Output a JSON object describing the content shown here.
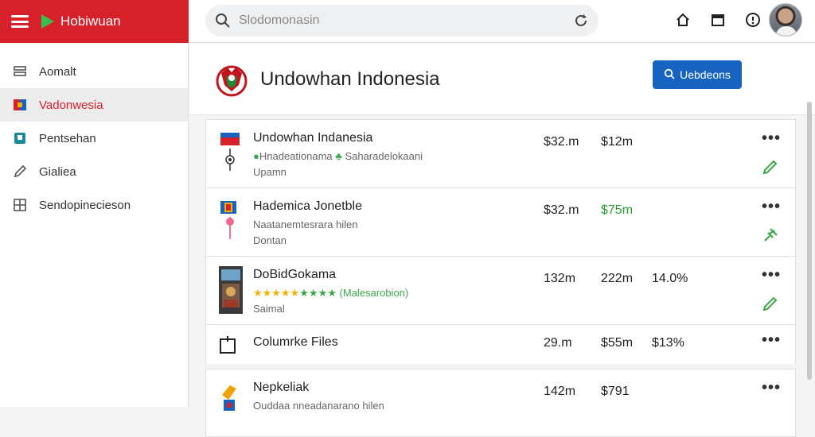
{
  "app": {
    "name": "Hobiwuan",
    "accent": "#d6202a"
  },
  "search": {
    "placeholder": "Slodomonasin"
  },
  "topbar": {
    "icons": [
      "home-icon",
      "calendar-icon",
      "info-icon",
      "avatar"
    ]
  },
  "sidebar": {
    "items": [
      {
        "label": "Aomalt",
        "icon": "layers-icon",
        "active": false
      },
      {
        "label": "Vadonwesia",
        "icon": "flag-icon",
        "active": true
      },
      {
        "label": "Pentsehan",
        "icon": "book-icon",
        "active": false
      },
      {
        "label": "Gialiea",
        "icon": "pencil-icon",
        "active": false
      },
      {
        "label": "Sendopinecieson",
        "icon": "grid-icon",
        "active": false
      }
    ]
  },
  "header": {
    "title": "Undowhan Indonesia",
    "button_label": "Uebdeons"
  },
  "rows": [
    {
      "name": "Undowhan Indanesia",
      "meta_a": "Hnadeationama",
      "meta_b": "Saharadelokaani",
      "sub": "Upamn",
      "v1": "$32.m",
      "v2": "$12m",
      "v3": ""
    },
    {
      "name": "Hademica Jonetble",
      "meta": "Naatanemtesrara hilen",
      "sub": "Dontan",
      "v1": "$32.m",
      "v2": "$75m",
      "v3": ""
    },
    {
      "name": "DoBidGokama",
      "stars": "★★★★★",
      "stars_green": "★★★★",
      "rating_label": "(Malesarobion)",
      "sub": "Saimal",
      "v1": "132m",
      "v2": "222m",
      "v3": "14.0%"
    },
    {
      "name": "Columrke Files",
      "v1": "29.m",
      "v2": "$55m",
      "v3": "$13%"
    },
    {
      "name": "Nepkeliak",
      "meta": "Ouddaa nneadanarano hilen",
      "v1": "142m",
      "v2": "$791",
      "v3": ""
    }
  ]
}
